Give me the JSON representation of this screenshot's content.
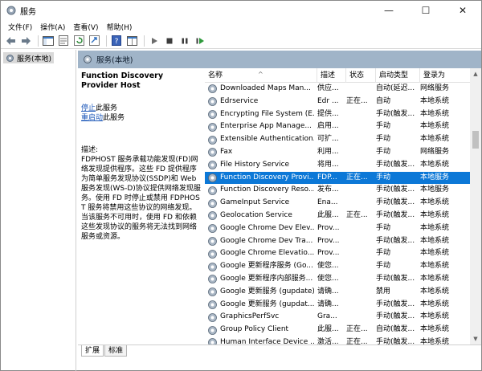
{
  "window": {
    "title": "服务",
    "minimize": "—",
    "maximize": "☐",
    "close": "✕"
  },
  "menu": [
    "文件(F)",
    "操作(A)",
    "查看(V)",
    "帮助(H)"
  ],
  "tree": {
    "root_label": "服务(本地)"
  },
  "content_header": {
    "label": "服务(本地)"
  },
  "description": {
    "service_title": "Function Discovery Provider Host",
    "stop_link": "停止",
    "stop_suffix": "此服务",
    "restart_link": "重启动",
    "restart_suffix": "此服务",
    "label": "描述:",
    "text": "FDPHOST 服务承载功能发现(FD)网络发现提供程序。这些 FD 提供程序为简单服务发现协议(SSDP)和 Web 服务发现(WS-D)协议提供网络发现服务。使用 FD 时停止或禁用 FDPHOST 服务将禁用这些协议的网络发现。当该服务不可用时，使用 FD 和依赖这些发现协议的服务将无法找到网络服务或资源。"
  },
  "columns": {
    "name": "名称",
    "description": "描述",
    "status": "状态",
    "startup": "启动类型",
    "logon": "登录为"
  },
  "rows": [
    {
      "name": "Downloaded Maps Man...",
      "description": "供应...",
      "status": "",
      "startup": "自动(延迟...",
      "logon": "网络服务"
    },
    {
      "name": "Edrservice",
      "description": "Edr ...",
      "status": "正在...",
      "startup": "自动",
      "logon": "本地系统"
    },
    {
      "name": "Encrypting File System (E...",
      "description": "提供...",
      "status": "",
      "startup": "手动(触发...",
      "logon": "本地系统"
    },
    {
      "name": "Enterprise App Manage...",
      "description": "启用...",
      "status": "",
      "startup": "手动",
      "logon": "本地系统"
    },
    {
      "name": "Extensible Authentication...",
      "description": "可扩...",
      "status": "",
      "startup": "手动",
      "logon": "本地系统"
    },
    {
      "name": "Fax",
      "description": "利用...",
      "status": "",
      "startup": "手动",
      "logon": "网络服务"
    },
    {
      "name": "File History Service",
      "description": "将用...",
      "status": "",
      "startup": "手动(触发...",
      "logon": "本地系统"
    },
    {
      "name": "Function Discovery Provi...",
      "description": "FDP...",
      "status": "正在...",
      "startup": "手动",
      "logon": "本地服务",
      "selected": true
    },
    {
      "name": "Function Discovery Reso...",
      "description": "发布...",
      "status": "",
      "startup": "手动(触发...",
      "logon": "本地服务"
    },
    {
      "name": "GameInput Service",
      "description": "Ena...",
      "status": "",
      "startup": "手动(触发...",
      "logon": "本地系统"
    },
    {
      "name": "Geolocation Service",
      "description": "此服...",
      "status": "正在...",
      "startup": "手动(触发...",
      "logon": "本地系统"
    },
    {
      "name": "Google Chrome Dev Elev...",
      "description": "Prov...",
      "status": "",
      "startup": "手动",
      "logon": "本地系统"
    },
    {
      "name": "Google Chrome Dev Tra...",
      "description": "Prov...",
      "status": "",
      "startup": "手动(触发...",
      "logon": "本地系统"
    },
    {
      "name": "Google Chrome Elevatio...",
      "description": "Prov...",
      "status": "",
      "startup": "手动",
      "logon": "本地系统"
    },
    {
      "name": "Google 更新程序服务 (Go...",
      "description": "使您...",
      "status": "",
      "startup": "手动",
      "logon": "本地系统"
    },
    {
      "name": "Google 更新程序内部服务...",
      "description": "使您...",
      "status": "",
      "startup": "手动(触发...",
      "logon": "本地系统"
    },
    {
      "name": "Google 更新服务 (gupdate)",
      "description": "请确...",
      "status": "",
      "startup": "禁用",
      "logon": "本地系统"
    },
    {
      "name": "Google 更新服务 (gupdat...",
      "description": "请确...",
      "status": "",
      "startup": "手动(触发...",
      "logon": "本地系统"
    },
    {
      "name": "GraphicsPerfSvc",
      "description": "Gra...",
      "status": "",
      "startup": "手动(触发...",
      "logon": "本地系统"
    },
    {
      "name": "Group Policy Client",
      "description": "此服...",
      "status": "正在...",
      "startup": "自动(触发...",
      "logon": "本地系统"
    },
    {
      "name": "Human Interface Device ...",
      "description": "激活...",
      "status": "正在...",
      "startup": "手动(触发...",
      "logon": "本地系统"
    }
  ],
  "tabs": [
    "扩展",
    "标准"
  ],
  "colors": {
    "header_bg": "#a0b4c8",
    "selection": "#0c78d7",
    "link": "#1a56b8"
  }
}
